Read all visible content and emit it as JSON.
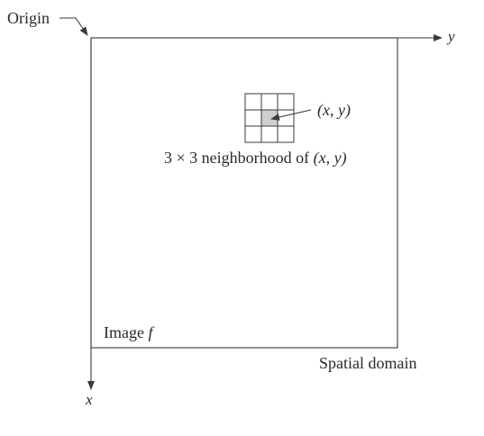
{
  "labels": {
    "origin": "Origin",
    "y_axis": "y",
    "x_axis": "x",
    "image": "Image ",
    "image_symbol": "f",
    "domain": "Spatial domain",
    "point": "(x, y)",
    "neighborhood_prefix": "3 × 3 neighborhood of ",
    "neighborhood_point": "(x, y)"
  },
  "neighborhood": {
    "rows": 3,
    "cols": 3,
    "center_fill": "#cfcfcf"
  },
  "colors": {
    "line": "#3a3a3a",
    "text": "#2a2a2a"
  }
}
